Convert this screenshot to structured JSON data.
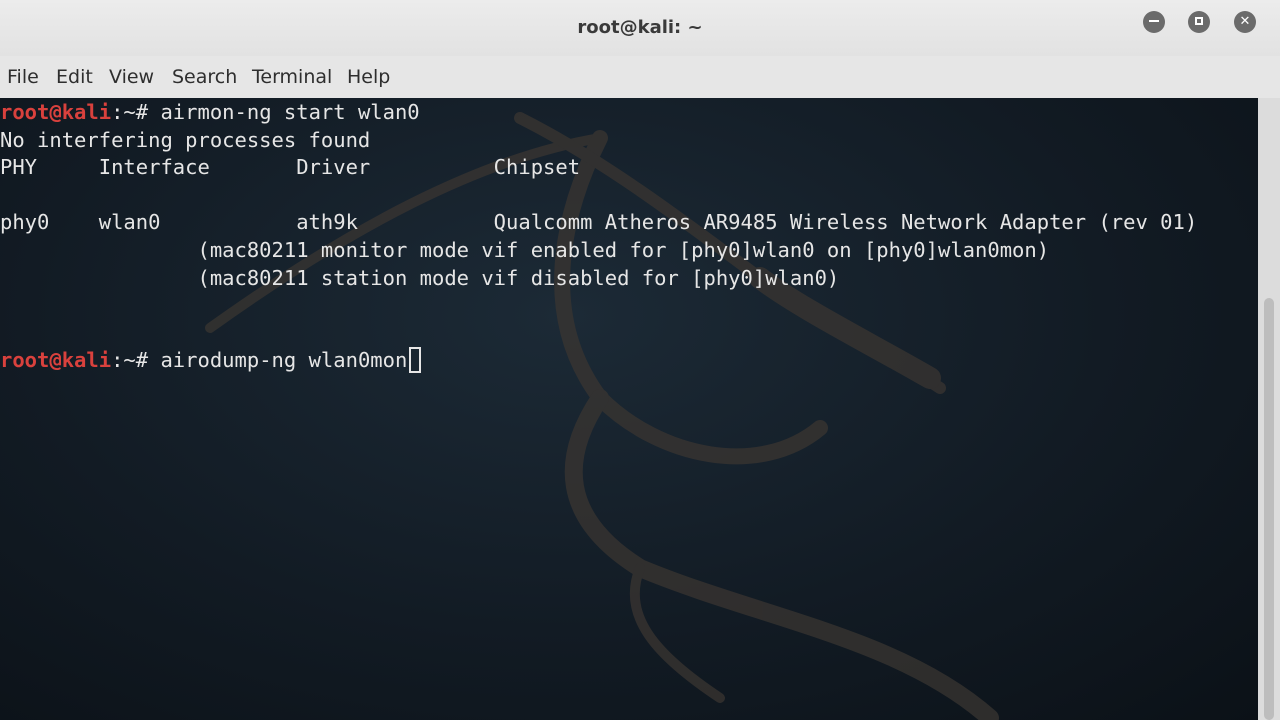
{
  "window": {
    "title": "root@kali: ~",
    "buttons": {
      "minimize": "minimize",
      "maximize": "maximize",
      "close": "close"
    }
  },
  "menu": [
    "File",
    "Edit",
    "View",
    "Search",
    "Terminal",
    "Help"
  ],
  "terminal": {
    "prompt_user": "root@kali",
    "prompt_suffix": ":~# ",
    "lines": [
      {
        "type": "prompt",
        "cmd": "airmon-ng start wlan0"
      },
      {
        "type": "text",
        "text": "No interfering processes found"
      },
      {
        "type": "text",
        "text": "PHY     Interface       Driver          Chipset"
      },
      {
        "type": "text",
        "text": ""
      },
      {
        "type": "text",
        "text": "phy0    wlan0           ath9k           Qualcomm Atheros AR9485 Wireless Network Adapter (rev 01)"
      },
      {
        "type": "text",
        "text": "                (mac80211 monitor mode vif enabled for [phy0]wlan0 on [phy0]wlan0mon)"
      },
      {
        "type": "text",
        "text": "                (mac80211 station mode vif disabled for [phy0]wlan0)"
      },
      {
        "type": "text",
        "text": ""
      },
      {
        "type": "text",
        "text": ""
      },
      {
        "type": "prompt",
        "cmd": "airodump-ng wlan0mon",
        "cursor": true
      }
    ]
  },
  "colors": {
    "prompt_user": "#d9413d",
    "text": "#e6e6e6",
    "background": "#121b24"
  }
}
